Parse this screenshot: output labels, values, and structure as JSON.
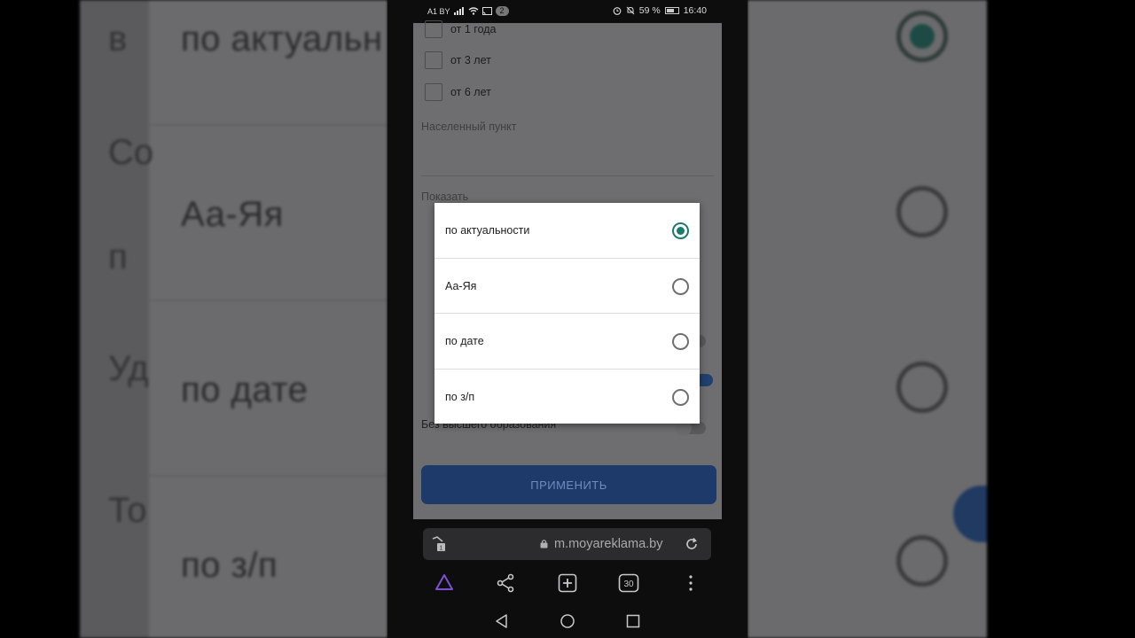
{
  "status_bar": {
    "carrier": "A1 BY",
    "notification_count": "2",
    "battery": "59 %",
    "time": "16:40"
  },
  "filters": {
    "experience_options": [
      "от 1 года",
      "от 3 лет",
      "от 6 лет"
    ],
    "city_label": "Населенный пункт",
    "show_label": "Показать",
    "toggle_label": "Без высшего образования"
  },
  "apply_button": "ПРИМЕНИТЬ",
  "sort_dialog": {
    "options": [
      {
        "label": "по актуальности",
        "selected": true
      },
      {
        "label": "Аа-Яя",
        "selected": false
      },
      {
        "label": "по дате",
        "selected": false
      },
      {
        "label": "по з/п",
        "selected": false
      }
    ]
  },
  "browser": {
    "url": "m.moyareklama.by",
    "tabs_count": "30",
    "incognito_tabs": "1"
  },
  "background_copy": {
    "rows": [
      "по актуальн",
      "Аа-Яя",
      "по дате",
      "по з/п"
    ],
    "side_text": [
      "в",
      "Со",
      "п",
      "Уд",
      "То"
    ]
  },
  "colors": {
    "accent": "#1a7a6e",
    "apply_button": "#1d3a6b",
    "dialog_bg": "#ffffff"
  }
}
